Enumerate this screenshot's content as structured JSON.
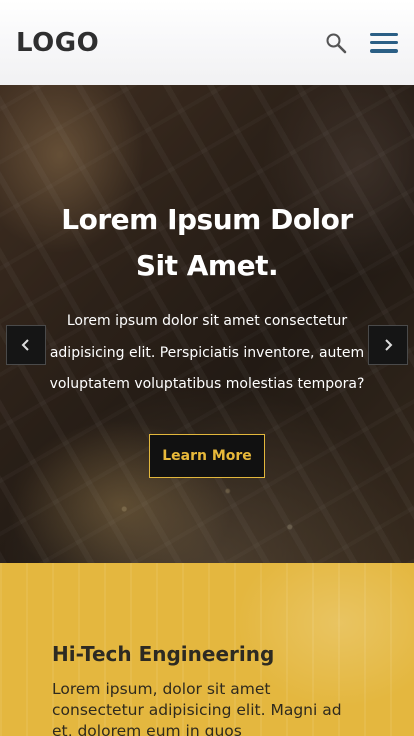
{
  "header": {
    "logo": "LOGO",
    "search_icon": "search-icon",
    "menu_icon": "hamburger-menu-icon",
    "accent_color": "#2b5f85"
  },
  "hero": {
    "title": "Lorem Ipsum Dolor Sit Amet.",
    "text": "Lorem ipsum dolor sit amet consectetur adipisicing elit. Perspiciatis inventore, autem voluptatem voluptatibus molestias tempora?",
    "cta_label": "Learn More",
    "cta_color": "#e8b93a",
    "prev_icon": "chevron-left-icon",
    "next_icon": "chevron-right-icon"
  },
  "feature": {
    "title": "Hi-Tech Engineering",
    "text": "Lorem ipsum, dolor sit amet consectetur adipisicing elit. Magni ad et, dolorem eum in quos",
    "background_color": "#e4b73f"
  }
}
